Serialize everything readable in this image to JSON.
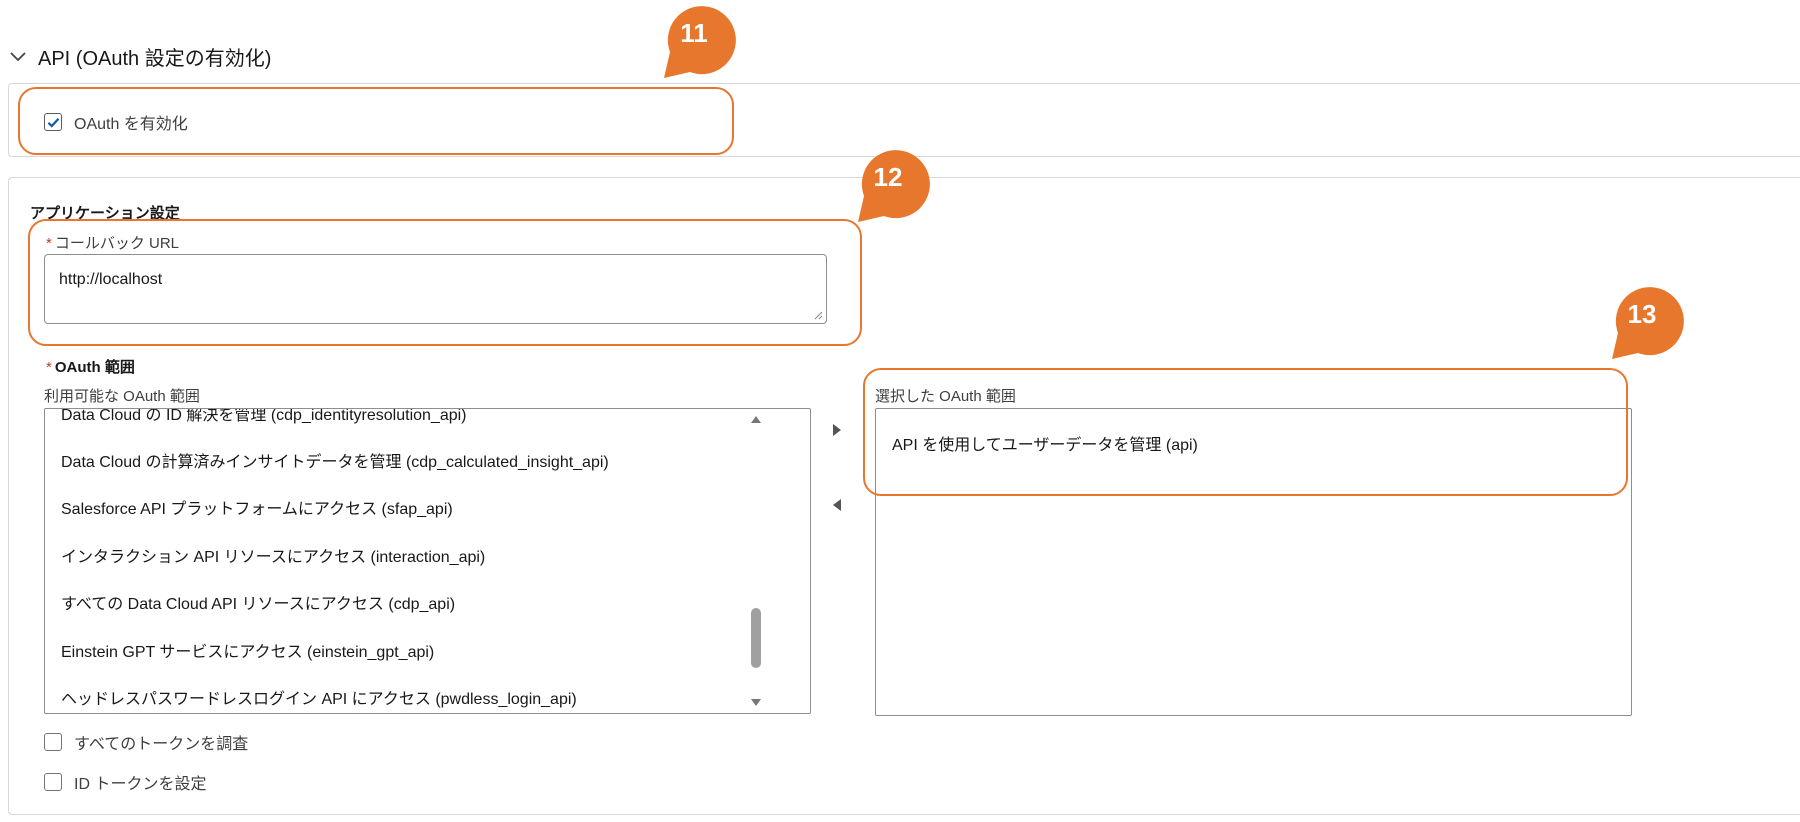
{
  "section": {
    "title": "API (OAuth 設定の有効化)",
    "icon": "chevron-down-icon"
  },
  "oauth": {
    "enable_label": "OAuth を有効化",
    "enabled": true
  },
  "app_settings": {
    "title": "アプリケーション設定",
    "callback_label": "コールバック URL",
    "callback_value": "http://localhost",
    "required_mark": "*"
  },
  "scopes": {
    "title": "OAuth 範囲",
    "available_label": "利用可能な OAuth 範囲",
    "selected_label": "選択した OAuth 範囲",
    "available": [
      "Data Cloud の ID 解決を管理 (cdp_identityresolution_api)",
      "Data Cloud の計算済みインサイトデータを管理 (cdp_calculated_insight_api)",
      "Salesforce API プラットフォームにアクセス (sfap_api)",
      "インタラクション API リソースにアクセス (interaction_api)",
      "すべての Data Cloud API リソースにアクセス (cdp_api)",
      "Einstein GPT サービスにアクセス (einstein_gpt_api)",
      "ヘッドレスパスワードレスログイン API にアクセス (pwdless_login_api)"
    ],
    "selected": [
      "API を使用してユーザーデータを管理 (api)"
    ]
  },
  "options": {
    "introspect_all_tokens": "すべてのトークンを調査",
    "configure_id_token": "ID トークンを設定"
  },
  "markers": [
    "11",
    "12",
    "13"
  ],
  "colors": {
    "accent": "#e8772e",
    "check": "#0b5cab"
  }
}
